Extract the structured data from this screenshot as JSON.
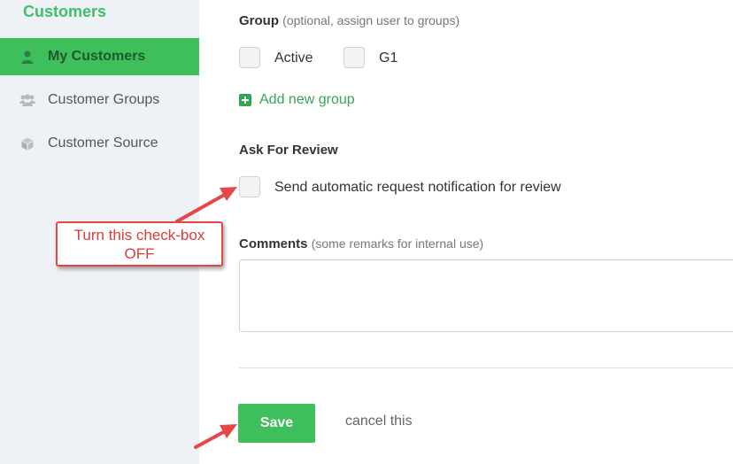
{
  "sidebar": {
    "title": "Customers",
    "items": [
      {
        "label": "My Customers",
        "icon": "user-icon",
        "active": true
      },
      {
        "label": "Customer Groups",
        "icon": "users-icon",
        "active": false
      },
      {
        "label": "Customer Source",
        "icon": "cube-icon",
        "active": false
      }
    ]
  },
  "group": {
    "label": "Group",
    "hint": "(optional, assign user to groups)",
    "options": [
      {
        "label": "Active",
        "checked": false
      },
      {
        "label": "G1",
        "checked": false
      }
    ],
    "add_label": "Add new group"
  },
  "review": {
    "label": "Ask For Review",
    "checkbox_label": "Send automatic request notification for review",
    "checked": false
  },
  "comments": {
    "label": "Comments",
    "hint": "(some remarks for internal use)",
    "value": ""
  },
  "actions": {
    "save_label": "Save",
    "cancel_label": "cancel this"
  },
  "annotation": {
    "line1": "Turn this check-box",
    "line2": "OFF",
    "color": "#e64646"
  },
  "colors": {
    "accent": "#3fbf5b",
    "sidebar_bg": "#eef1f6"
  }
}
